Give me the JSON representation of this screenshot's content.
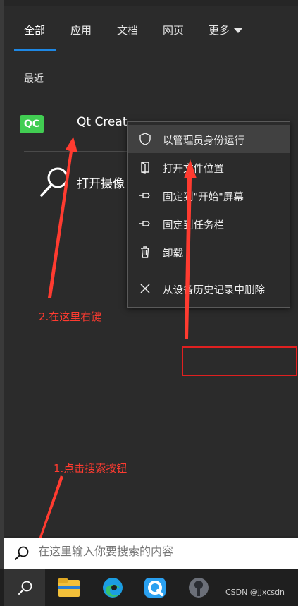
{
  "tabs": [
    {
      "label": "全部",
      "active": true
    },
    {
      "label": "应用"
    },
    {
      "label": "文档"
    },
    {
      "label": "网页"
    },
    {
      "label": "更多"
    }
  ],
  "section_title": "最近",
  "recent_apps": [
    {
      "label": "Qt Creat",
      "icon": "qt-creator-icon",
      "icon_text": "QC"
    },
    {
      "label": "打开摄像",
      "icon": "search-icon"
    }
  ],
  "context_menu": {
    "items": [
      {
        "label": "以管理员身份运行",
        "icon": "shield-icon",
        "highlighted": true
      },
      {
        "label": "打开文件位置",
        "icon": "folder-open-icon"
      },
      {
        "label": "固定到\"开始\"屏幕",
        "icon": "pin-icon"
      },
      {
        "label": "固定到任务栏",
        "icon": "pin-icon"
      },
      {
        "label": "卸载",
        "icon": "trash-icon"
      },
      {
        "label": "从设备历史记录中删除",
        "icon": "close-icon"
      }
    ]
  },
  "annotations": {
    "step1": "1.点击搜索按钮",
    "step2": "2.在这里右键"
  },
  "search": {
    "placeholder": "在这里输入你要搜索的内容"
  },
  "taskbar": {
    "apps": [
      "file-explorer-icon",
      "edge-icon",
      "browser-q-icon",
      "app-icon"
    ]
  },
  "watermark": "CSDN @jjxcsdn",
  "colors": {
    "accent": "#1e88e5",
    "annotation": "#ff3b30",
    "qt_green": "#41cd52"
  }
}
